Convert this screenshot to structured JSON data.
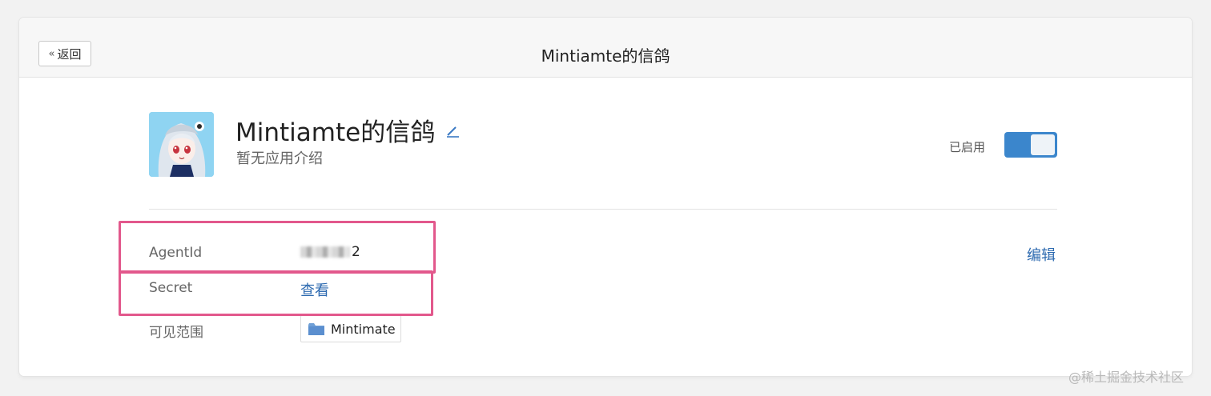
{
  "header": {
    "back_label": "返回",
    "title": "Mintiamte的信鸽"
  },
  "app": {
    "name": "Mintiamte的信鸽",
    "description": "暂无应用介绍",
    "status_label": "已启用",
    "enabled": true
  },
  "fields": {
    "agentid_label": "AgentId",
    "agentid_visible_suffix": "2",
    "secret_label": "Secret",
    "secret_action": "查看",
    "scope_label": "可见范围",
    "scope_value": "Mintimate"
  },
  "actions": {
    "edit_label": "编辑"
  },
  "watermark": "@稀土掘金技术社区",
  "colors": {
    "accent": "#2d6ab0",
    "toggle_on": "#3b86cc",
    "highlight": "#e2588c"
  },
  "icons": [
    "double-chevron-left-icon",
    "pencil-icon",
    "folder-icon"
  ]
}
